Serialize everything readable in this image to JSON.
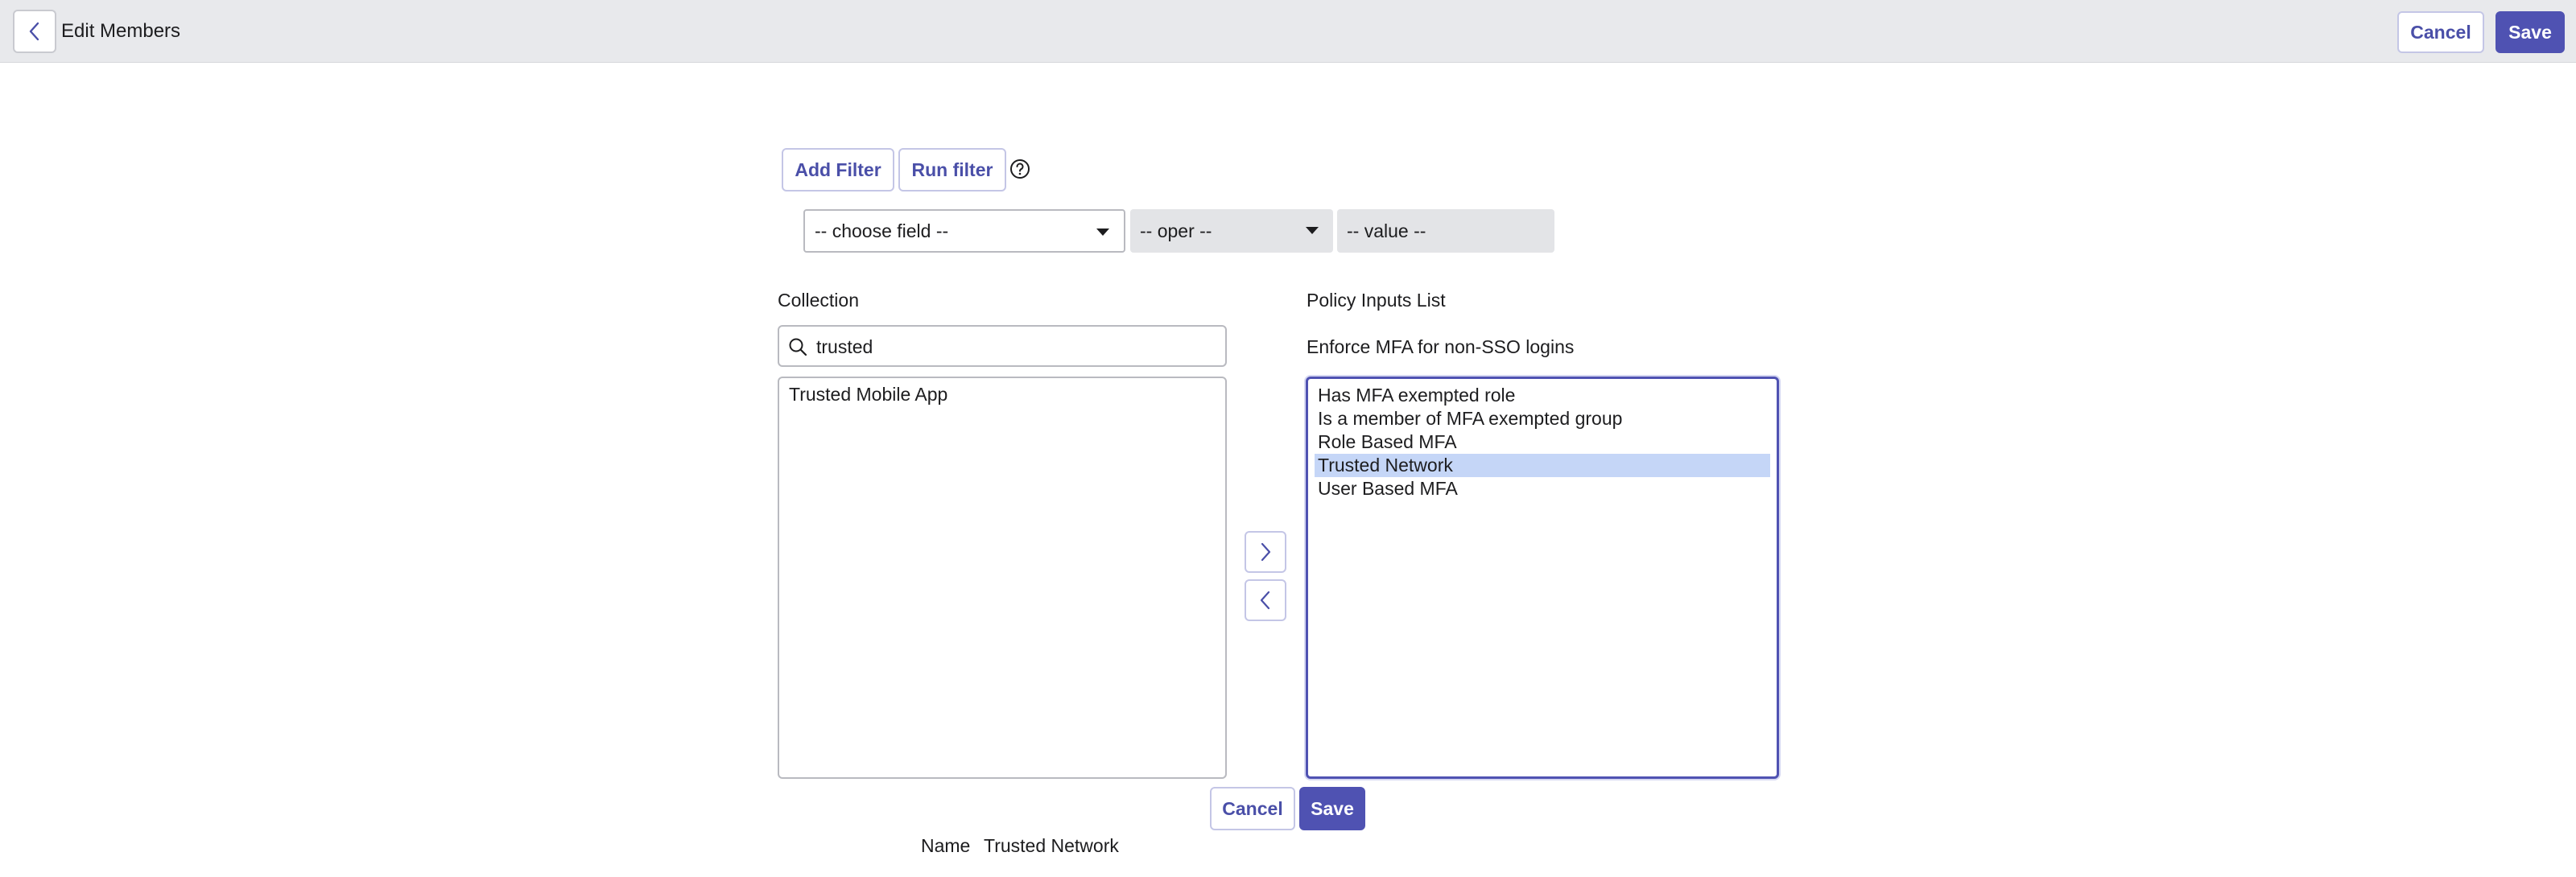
{
  "header": {
    "title": "Edit Members",
    "cancel_label": "Cancel",
    "save_label": "Save"
  },
  "filter": {
    "add_filter_label": "Add Filter",
    "run_filter_label": "Run filter",
    "field_select": "-- choose field --",
    "oper_select": "-- oper --",
    "value_placeholder": "-- value --"
  },
  "collection": {
    "label": "Collection",
    "search_value": "trusted",
    "items": [
      "Trusted Mobile App"
    ]
  },
  "policy": {
    "label": "Policy Inputs List",
    "sublabel": "Enforce MFA for non-SSO logins",
    "items": [
      "Has MFA exempted role",
      "Is a member of MFA exempted group",
      "Role Based MFA",
      "Trusted Network",
      "User Based MFA"
    ],
    "selected": "Trusted Network"
  },
  "footer": {
    "cancel_label": "Cancel",
    "save_label": "Save",
    "name_label": "Name",
    "name_value": "Trusted Network"
  },
  "colors": {
    "accent": "#4f52b2",
    "header_bg": "#e8e9ec",
    "selection": "#c5d6f7"
  },
  "icons": {
    "back": "chevron-left-icon",
    "help": "help-circle-icon",
    "search": "search-icon",
    "move_right": "chevron-right-icon",
    "move_left": "chevron-left-icon"
  }
}
